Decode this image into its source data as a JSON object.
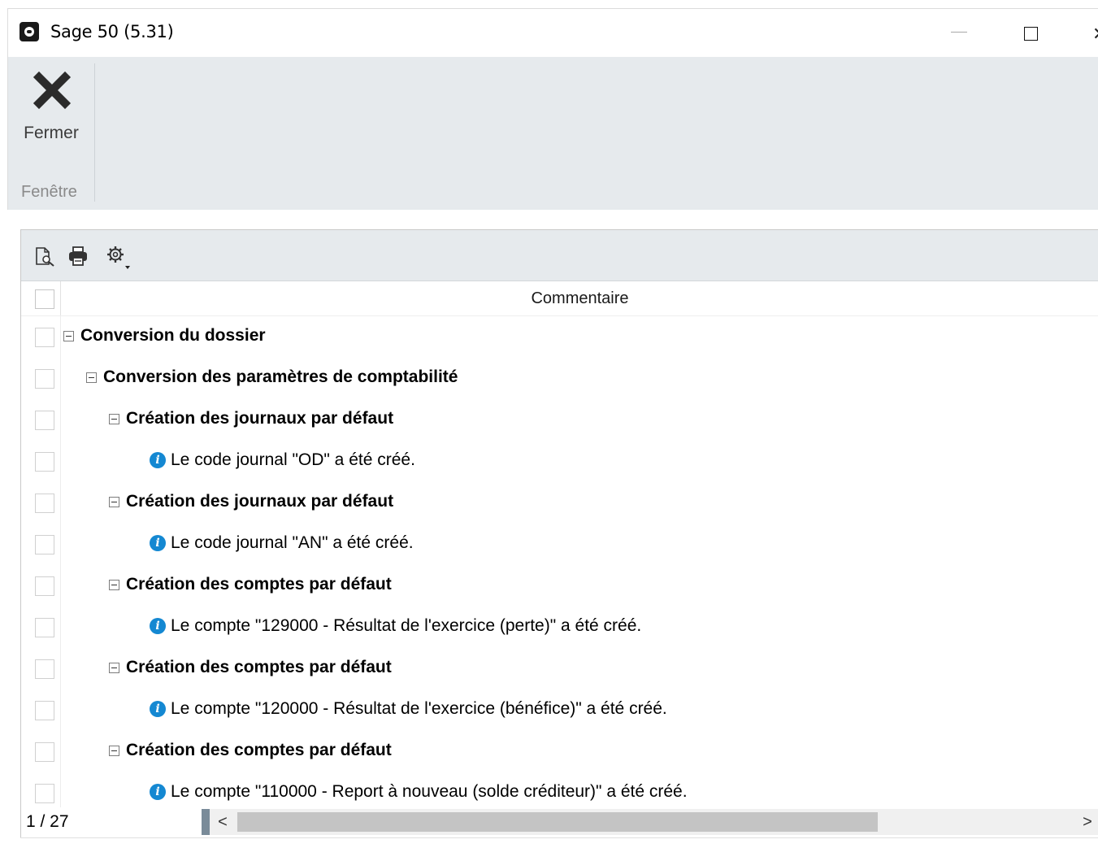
{
  "window": {
    "title": "Sage 50 (5.31)",
    "app_icon": "sage-logo-icon",
    "controls": [
      "minimize-icon",
      "maximize-icon",
      "close-icon"
    ]
  },
  "ribbon": {
    "close_button_label": "Fermer",
    "close_button_icon": "close-x-icon",
    "group_label": "Fenêtre"
  },
  "grid_toolbar": {
    "icons": [
      "print-preview-icon",
      "print-icon",
      "settings-gear-icon",
      "dropdown-arrow-icon"
    ]
  },
  "grid": {
    "column_header": "Commentaire",
    "rows": [
      {
        "level": 0,
        "kind": "group",
        "text": "Conversion du dossier"
      },
      {
        "level": 1,
        "kind": "group",
        "text": "Conversion des paramètres de comptabilité"
      },
      {
        "level": 2,
        "kind": "group",
        "text": "Création des journaux par défaut"
      },
      {
        "level": 3,
        "kind": "info",
        "text": "Le code journal \"OD\" a été créé."
      },
      {
        "level": 2,
        "kind": "group",
        "text": "Création des journaux par défaut"
      },
      {
        "level": 3,
        "kind": "info",
        "text": "Le code journal \"AN\" a été créé."
      },
      {
        "level": 2,
        "kind": "group",
        "text": "Création des comptes par défaut"
      },
      {
        "level": 3,
        "kind": "info",
        "text": "Le compte \"129000 - Résultat de l'exercice (perte)\" a été créé."
      },
      {
        "level": 2,
        "kind": "group",
        "text": "Création des comptes par défaut"
      },
      {
        "level": 3,
        "kind": "info",
        "text": "Le compte \"120000 - Résultat de l'exercice (bénéfice)\" a été créé."
      },
      {
        "level": 2,
        "kind": "group",
        "text": "Création des comptes par défaut"
      },
      {
        "level": 3,
        "kind": "info",
        "text": "Le compte \"110000 - Report à nouveau (solde créditeur)\" a été créé."
      }
    ]
  },
  "status": {
    "record_count": "1 / 27",
    "scroll_left": "<",
    "scroll_right": ">"
  },
  "colors": {
    "ribbon_bg": "#e6eaed",
    "info_icon": "#1488d2",
    "count_edge": "#7a8b99"
  }
}
